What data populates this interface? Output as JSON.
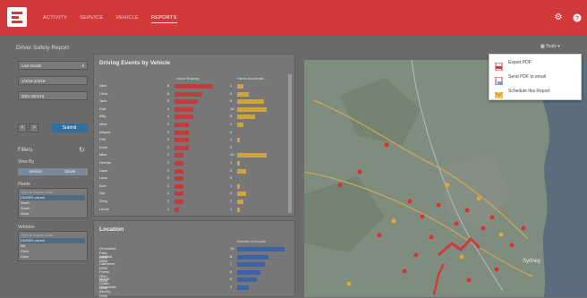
{
  "nav": {
    "items": [
      "ACTIVITY",
      "SERVICE",
      "VEHICLE",
      "REPORTS"
    ],
    "active": "REPORTS"
  },
  "page": {
    "title": "Driver Safety Report",
    "tools_label": "Tools"
  },
  "left": {
    "period": "Last month",
    "date_from": "1/4/16-1/4/16",
    "date_to": "30/4-30/4/16",
    "prev": "<",
    "next": ">",
    "submit": "Submit",
    "filters_label": "Filters",
    "view_by_label": "View By",
    "view_by_options": [
      "Vehicle",
      "Driver"
    ],
    "fleets_label": "Fleets",
    "fleets_placeholder": "Type to search a list",
    "fleets_items": [
      "UNDER values",
      "North",
      "South",
      "West"
    ],
    "vehicles_label": "Vehicles",
    "vehicles_placeholder": "Type to search a list",
    "vehicles_items": [
      "UNDER values",
      "Bill",
      "Chris",
      "Dave"
    ]
  },
  "events_panel": {
    "title": "Driving Events by Vehicle",
    "col1": "Harsh Braking",
    "col2": "Harsh Accelerati...",
    "rows": [
      {
        "name": "Neel",
        "v1": 8,
        "v2": 2
      },
      {
        "name": "Chris",
        "v1": 6,
        "v2": 4
      },
      {
        "name": "Jack",
        "v1": 5,
        "v2": 9
      },
      {
        "name": "Rob",
        "v1": 4,
        "v2": 10
      },
      {
        "name": "Billy",
        "v1": 4,
        "v2": 6
      },
      {
        "name": "Mike",
        "v1": 3,
        "v2": 2
      },
      {
        "name": "Wayne",
        "v1": 3,
        "v2": 0
      },
      {
        "name": "Phil",
        "v1": 3,
        "v2": 1
      },
      {
        "name": "Keith",
        "v1": 3,
        "v2": 0
      },
      {
        "name": "Mike",
        "v1": 2,
        "v2": 10
      },
      {
        "name": "Dennis",
        "v1": 2,
        "v2": 1
      },
      {
        "name": "Dave",
        "v1": 2,
        "v2": 3
      },
      {
        "name": "Leon",
        "v1": 2,
        "v2": 0
      },
      {
        "name": "Kurt",
        "v1": 2,
        "v2": 1
      },
      {
        "name": "Sal",
        "v1": 2,
        "v2": 3
      },
      {
        "name": "Greg",
        "v1": 2,
        "v2": 2
      },
      {
        "name": "Lance",
        "v1": 1,
        "v2": 1
      }
    ]
  },
  "location_panel": {
    "title": "Location",
    "col": "Number of Events",
    "rows": [
      {
        "name": "Greenfield Park, NSW",
        "v": 12
      },
      {
        "name": "Ashfield, NSW",
        "v": 8
      },
      {
        "name": "Cabdrove, NSW",
        "v": 7
      },
      {
        "name": "Forest Glen, NSW",
        "v": 6
      },
      {
        "name": "Mount Colah, NSW",
        "v": 5
      },
      {
        "name": "Greendale (North), NSW",
        "v": 3
      }
    ]
  },
  "tools_menu": {
    "items": [
      {
        "label": "Export PDF",
        "icon": "pdf-icon"
      },
      {
        "label": "Send PDF to email",
        "icon": "email-pdf-icon"
      },
      {
        "label": "Schedule this Report",
        "icon": "schedule-icon"
      }
    ]
  },
  "map": {
    "label": "Sydney"
  },
  "colors": {
    "brand": "#d23a3a",
    "harsh_braking": "#c23c3c",
    "harsh_accel": "#cfa43a",
    "location": "#3c62a8",
    "submit": "#2f6fa2"
  }
}
